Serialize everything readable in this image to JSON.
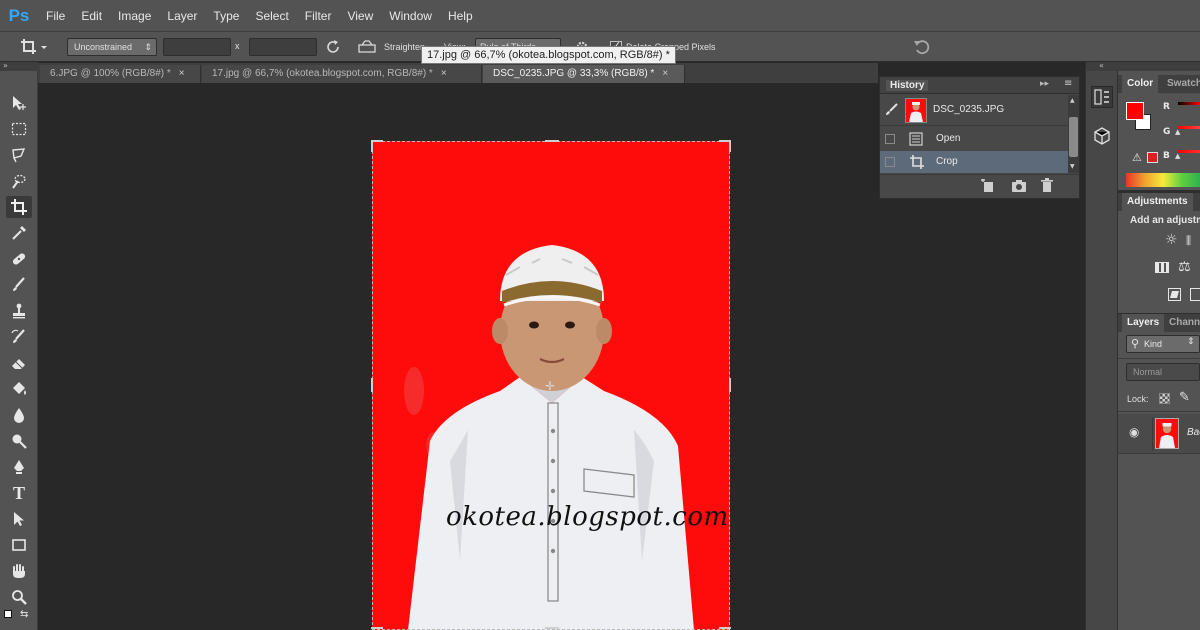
{
  "app": {
    "logo": "Ps"
  },
  "menu": [
    "File",
    "Edit",
    "Image",
    "Layer",
    "Type",
    "Select",
    "Filter",
    "View",
    "Window",
    "Help"
  ],
  "options": {
    "preset": "Unconstrained",
    "x_separator": "x",
    "straighten": "Straighten",
    "view_label": "View:",
    "view_value": "Rule of Thirds",
    "delete_cropped": "Delete Cropped Pixels"
  },
  "tooltip": "17.jpg @ 66,7% (okotea.blogspot.com, RGB/8#) *",
  "tabs": [
    {
      "label": "6.JPG @ 100% (RGB/8#) *",
      "close": "×"
    },
    {
      "label": "17.jpg @ 66,7% (okotea.blogspot.com, RGB/8#) *",
      "close": "×"
    },
    {
      "label": "DSC_0235.JPG @ 33,3% (RGB/8) *",
      "close": "×"
    }
  ],
  "watermark": "okotea.blogspot.com",
  "history": {
    "title": "History",
    "snapshot": "DSC_0235.JPG",
    "items": [
      {
        "label": "Open",
        "icon": "document-icon",
        "selected": false
      },
      {
        "label": "Crop",
        "icon": "crop-icon",
        "selected": true
      }
    ]
  },
  "right_panels": {
    "color_tab": "Color",
    "swatches_tab": "Swatches",
    "channel_r": "R",
    "channel_g": "G",
    "channel_b": "B",
    "adjustments_tab": "Adjustments",
    "adjustments_hint": "Add an adjustment",
    "layers_tab": "Layers",
    "channels_tab": "Channels",
    "kind": "Kind",
    "blend_mode": "Normal",
    "lock_label": "Lock:",
    "layer_name": "Background"
  },
  "colors": {
    "foreground": "#ff0000",
    "background": "#ffffff",
    "photo_bg": "#fe0b0b",
    "history_selected": "#5c6a7a"
  }
}
